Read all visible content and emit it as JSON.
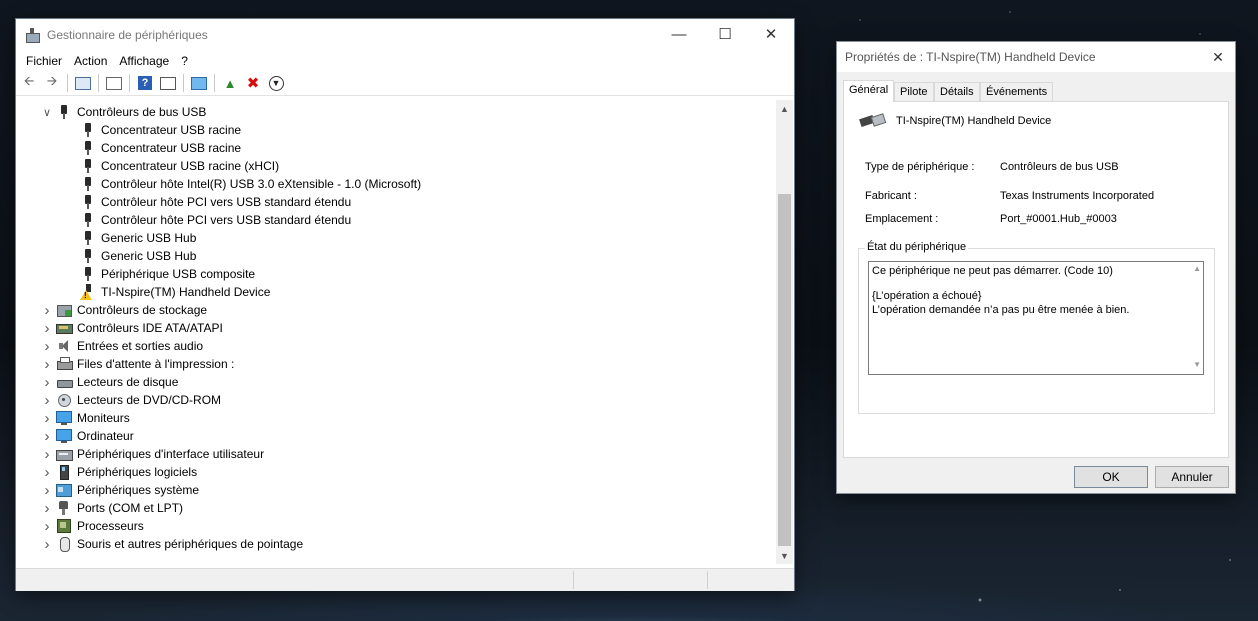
{
  "device_manager": {
    "title": "Gestionnaire de périphériques",
    "menu": [
      "Fichier",
      "Action",
      "Affichage",
      "?"
    ],
    "toolbar_icons": [
      "back-arrow-icon",
      "forward-arrow-icon",
      "properties-list-icon",
      "details-view-icon",
      "help-icon",
      "resources-view-icon",
      "monitor-scan-icon",
      "update-driver-icon",
      "uninstall-icon",
      "download-icon"
    ],
    "tree": [
      {
        "label": "Contrôleurs de bus USB",
        "icon": "usb-icon",
        "level": 0,
        "expanded": true
      },
      {
        "label": "Concentrateur USB racine",
        "icon": "usb-icon",
        "level": 1
      },
      {
        "label": "Concentrateur USB racine",
        "icon": "usb-icon",
        "level": 1
      },
      {
        "label": "Concentrateur USB racine (xHCI)",
        "icon": "usb-icon",
        "level": 1
      },
      {
        "label": "Contrôleur hôte Intel(R) USB 3.0 eXtensible - 1.0 (Microsoft)",
        "icon": "usb-icon",
        "level": 1
      },
      {
        "label": "Contrôleur hôte PCI vers USB standard étendu",
        "icon": "usb-icon",
        "level": 1
      },
      {
        "label": "Contrôleur hôte PCI vers USB standard étendu",
        "icon": "usb-icon",
        "level": 1
      },
      {
        "label": "Generic USB Hub",
        "icon": "usb-icon",
        "level": 1
      },
      {
        "label": "Generic USB Hub",
        "icon": "usb-icon",
        "level": 1
      },
      {
        "label": "Périphérique USB composite",
        "icon": "usb-icon",
        "level": 1
      },
      {
        "label": "TI-Nspire(TM) Handheld Device",
        "icon": "usb-warning-icon",
        "level": 1
      },
      {
        "label": "Contrôleurs de stockage",
        "icon": "storage-controller-icon",
        "level": 0,
        "expanded": false
      },
      {
        "label": "Contrôleurs IDE ATA/ATAPI",
        "icon": "ide-controller-icon",
        "level": 0,
        "expanded": false
      },
      {
        "label": "Entrées et sorties audio",
        "icon": "speaker-icon",
        "level": 0,
        "expanded": false
      },
      {
        "label": "Files d'attente à l'impression :",
        "icon": "printer-icon",
        "level": 0,
        "expanded": false
      },
      {
        "label": "Lecteurs de disque",
        "icon": "disk-drive-icon",
        "level": 0,
        "expanded": false
      },
      {
        "label": "Lecteurs de DVD/CD-ROM",
        "icon": "dvd-icon",
        "level": 0,
        "expanded": false
      },
      {
        "label": "Moniteurs",
        "icon": "monitor-icon",
        "level": 0,
        "expanded": false
      },
      {
        "label": "Ordinateur",
        "icon": "computer-icon",
        "level": 0,
        "expanded": false
      },
      {
        "label": "Périphériques d'interface utilisateur",
        "icon": "hid-icon",
        "level": 0,
        "expanded": false
      },
      {
        "label": "Périphériques logiciels",
        "icon": "software-device-icon",
        "level": 0,
        "expanded": false
      },
      {
        "label": "Périphériques système",
        "icon": "system-device-icon",
        "level": 0,
        "expanded": false
      },
      {
        "label": "Ports (COM et LPT)",
        "icon": "port-icon",
        "level": 0,
        "expanded": false
      },
      {
        "label": "Processeurs",
        "icon": "processor-icon",
        "level": 0,
        "expanded": false
      },
      {
        "label": "Souris et autres périphériques de pointage",
        "icon": "mouse-icon",
        "level": 0,
        "expanded": false
      }
    ]
  },
  "properties": {
    "title": "Propriétés de : TI-Nspire(TM) Handheld Device",
    "tabs": [
      "Général",
      "Pilote",
      "Détails",
      "Événements"
    ],
    "active_tab": "Général",
    "device_name": "TI-Nspire(TM) Handheld Device",
    "fields": [
      {
        "label": "Type de périphérique :",
        "value": "Contrôleurs de bus USB"
      },
      {
        "label": "Fabricant :",
        "value": "Texas Instruments Incorporated"
      },
      {
        "label": "Emplacement :",
        "value": "Port_#0001.Hub_#0003"
      }
    ],
    "status_group_label": "État du périphérique",
    "status_lines": [
      "Ce périphérique ne peut pas démarrer. (Code 10)",
      "",
      "{L’opération a échoué}",
      "L’opération demandée n’a pas pu être menée à bien."
    ],
    "ok_label": "OK",
    "cancel_label": "Annuler"
  }
}
